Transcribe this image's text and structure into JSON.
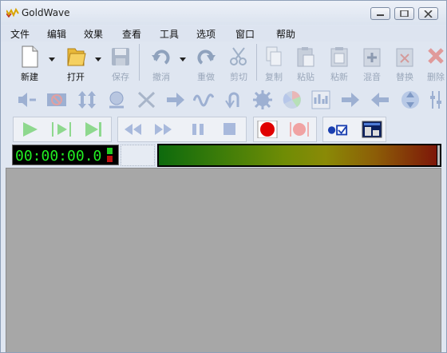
{
  "window": {
    "title": "GoldWave"
  },
  "menu": [
    "文件",
    "编辑",
    "效果",
    "查看",
    "工具",
    "选项",
    "窗口",
    "帮助"
  ],
  "toolbar": {
    "buttons": [
      {
        "label": "新建",
        "enabled": true
      },
      {
        "label": "打开",
        "enabled": true
      },
      {
        "label": "保存",
        "enabled": false
      },
      {
        "label": "撤消",
        "enabled": false
      },
      {
        "label": "重做",
        "enabled": false
      },
      {
        "label": "剪切",
        "enabled": false
      },
      {
        "label": "复制",
        "enabled": false
      },
      {
        "label": "粘贴",
        "enabled": false
      },
      {
        "label": "粘新",
        "enabled": false
      },
      {
        "label": "混音",
        "enabled": false
      },
      {
        "label": "替换",
        "enabled": false
      },
      {
        "label": "删除",
        "enabled": false
      }
    ]
  },
  "effects_toolbar": {
    "icons": [
      "volume-left-icon",
      "no-icon",
      "vertical-arrows-icon",
      "sphere-icon",
      "scissors-x-icon",
      "arrow-right-curve-icon",
      "wave-icon",
      "undo-curve-icon",
      "gear-icon",
      "color-wheel-icon",
      "equalizer-icon",
      "arrow-right-icon",
      "arrow-left-icon",
      "compress-icon",
      "sliders-icon"
    ]
  },
  "transport": {
    "icons": [
      "play-icon",
      "play-selection-icon",
      "play-to-end-icon",
      "rewind-icon",
      "fast-forward-icon",
      "pause-icon",
      "stop-icon",
      "record-icon",
      "record-selection-icon",
      "control-properties-icon",
      "level-meter-icon"
    ]
  },
  "status": {
    "time": "00:00:00.0"
  },
  "colors": {
    "meter_start": "#0d6a0d",
    "meter_end": "#7d1709",
    "time_text": "#22ee22",
    "workspace": "#a7a7a7"
  }
}
